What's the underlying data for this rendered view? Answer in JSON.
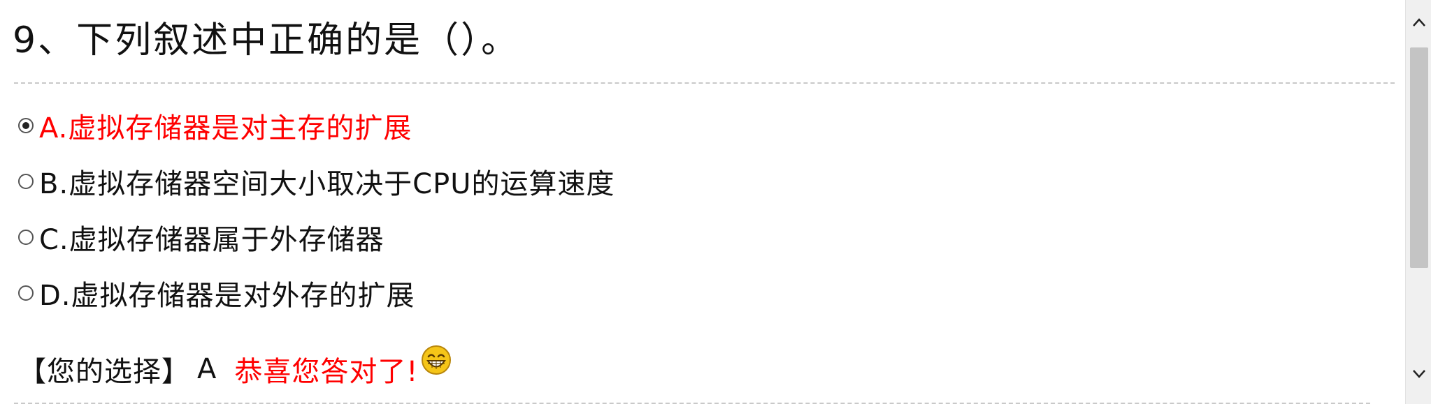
{
  "question": {
    "title": "9、下列叙述中正确的是（）。"
  },
  "options": [
    {
      "text": "A.虚拟存储器是对主存的扩展",
      "selected": true
    },
    {
      "text": "B.虚拟存储器空间大小取决于CPU的运算速度",
      "selected": false
    },
    {
      "text": "C.虚拟存储器属于外存储器",
      "selected": false
    },
    {
      "text": "D.虚拟存储器是对外存的扩展",
      "selected": false
    }
  ],
  "result": {
    "label": "【您的选择】",
    "answer": "A",
    "message": "恭喜您答对了!",
    "icon": "grinning-smiley-icon"
  },
  "colors": {
    "correct": "#ff0000",
    "text": "#111111",
    "divider": "#c9c9c9",
    "scroll_track": "#f0f0f0",
    "scroll_thumb": "#c4c4c4",
    "smiley_face": "#f5c518"
  }
}
